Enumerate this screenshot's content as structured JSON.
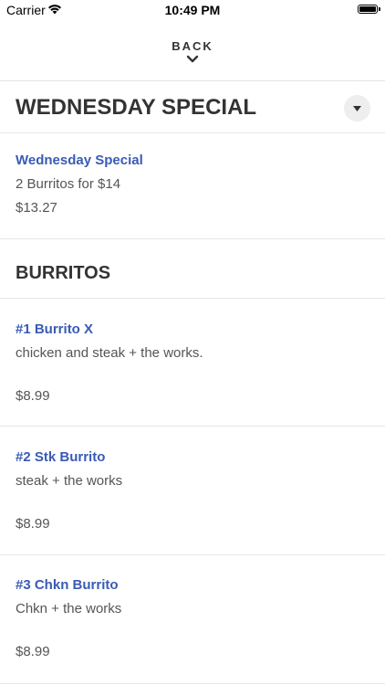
{
  "status_bar": {
    "carrier": "Carrier",
    "time": "10:49 PM"
  },
  "header": {
    "back_label": "BACK"
  },
  "special_section": {
    "title": "WEDNESDAY SPECIAL",
    "item": {
      "name": "Wednesday Special",
      "description": "2 Burritos for $14",
      "price": "$13.27"
    }
  },
  "burritos_section": {
    "title": "BURRITOS",
    "items": [
      {
        "name": "#1 Burrito X",
        "description": "chicken and steak + the works.",
        "price": "$8.99"
      },
      {
        "name": "#2 Stk Burrito",
        "description": "steak + the works",
        "price": "$8.99"
      },
      {
        "name": "#3 Chkn Burrito",
        "description": "Chkn + the works",
        "price": "$8.99"
      }
    ]
  },
  "colors": {
    "accent": "#3a5bb5",
    "text": "#333333",
    "divider": "#e6e6e6"
  },
  "icons": [
    "wifi-icon",
    "battery-icon",
    "chevron-down-icon",
    "dropdown-triangle-icon"
  ]
}
